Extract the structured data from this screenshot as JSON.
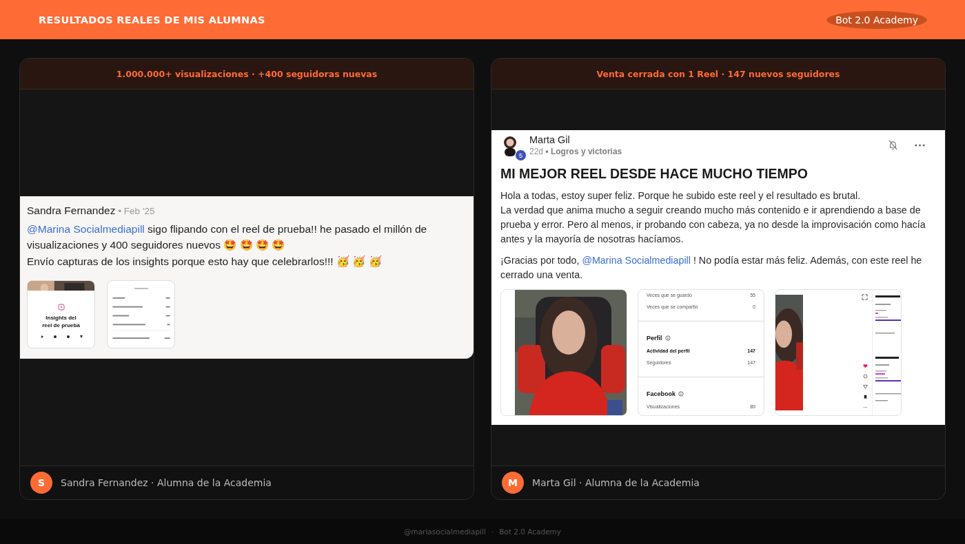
{
  "header": {
    "title": "RESULTADOS REALES DE MIS ALUMNAS",
    "badge": "Bot 2.0 Academy"
  },
  "cards": [
    {
      "headline": "1.000.000+ visualizaciones · +400 seguidoras nuevas",
      "post": {
        "kind": "comment",
        "author": "Sandra Fernandez",
        "meta": "• Feb '25",
        "paragraphs": [
          {
            "lines": [
              {
                "mention": "@Marina Socialmediapill",
                "after": " sigo flipando con el reel de prueba!! he pasado el millón de visualizaciones y 400 seguidores nuevos 🤩 🤩 🤩 🤩"
              },
              {
                "after": "Envío capturas de los insights porque esto hay que celebrarlos!!! 🥳 🥳 🥳"
              }
            ]
          }
        ],
        "thumbs": [
          {
            "kind": "cover",
            "title": "Insights del reel de prueba"
          },
          {
            "kind": "list"
          }
        ]
      },
      "student": {
        "initial": "S",
        "caption": "Sandra Fernandez · Alumna de la Academia"
      }
    },
    {
      "headline": "Venta cerrada con 1 Reel · 147 nuevos seguidores",
      "post": {
        "kind": "post",
        "author": "Marta Gil",
        "badge": "5",
        "age": "22d",
        "category": "• Logros y victorias",
        "title": "MI MEJOR REEL DESDE HACE MUCHO TIEMPO",
        "paragraphs": [
          {
            "lines": [
              {
                "after": "Hola a todas, estoy super feliz. Porque he subido este reel y el resultado es brutal."
              },
              {
                "after": "La verdad que anima mucho a seguir creando mucho más contenido e ir aprendiendo a base de prueba y error. Pero al menos, ir probando con cabeza, ya no desde la improvisación como hacía antes y la mayoría de nosotras hacíamos."
              }
            ]
          },
          {
            "lines": [
              {
                "before": "¡Gracias por todo, ",
                "mention": "@Marina Socialmediapill",
                "after": " ! No podía estar más feliz. Además, con este reel he cerrado una venta."
              }
            ]
          }
        ],
        "thumbs": [
          {
            "kind": "picture"
          },
          {
            "kind": "sections",
            "sections": [
              {
                "rows": [
                  {
                    "label": "Veces que se guardó",
                    "value": "55",
                    "strong": false
                  },
                  {
                    "label": "Veces que se compartió",
                    "value": "0",
                    "strong": false
                  }
                ]
              },
              {
                "title": "Perfil",
                "rows": [
                  {
                    "label": "Actividad del perfil",
                    "value": "147",
                    "strong": true
                  },
                  {
                    "label": "Seguidores",
                    "value": "147",
                    "strong": false
                  }
                ]
              },
              {
                "title": "Facebook",
                "rows": [
                  {
                    "label": "Visualizaciones",
                    "value": "89",
                    "strong": false
                  }
                ]
              }
            ]
          },
          {
            "kind": "video"
          }
        ]
      },
      "student": {
        "initial": "M",
        "caption": "Marta Gil · Alumna de la Academia"
      }
    }
  ],
  "footer": {
    "handle": "@mariasocialmediapill",
    "separator": "·",
    "brand": "Bot 2.0 Academy"
  }
}
